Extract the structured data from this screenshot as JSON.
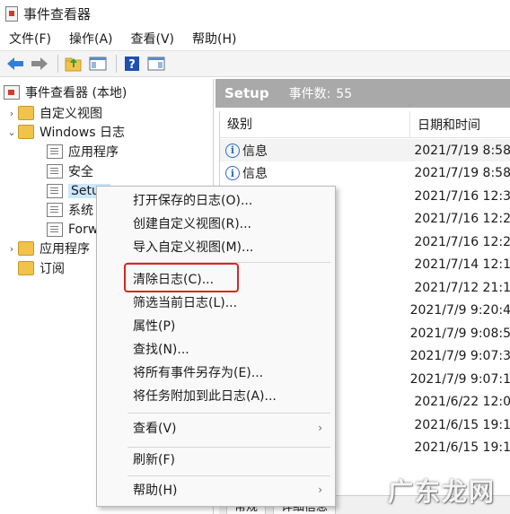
{
  "window": {
    "title": "事件查看器"
  },
  "menubar": [
    "文件(F)",
    "操作(A)",
    "查看(V)",
    "帮助(H)"
  ],
  "toolbar": {
    "icons": [
      "back-arrow-icon",
      "forward-arrow-icon",
      "folder-up-icon",
      "show-hide-tree-icon",
      "help-icon",
      "show-action-pane-icon"
    ]
  },
  "tree": {
    "root": "事件查看器 (本地)",
    "custom_views": "自定义视图",
    "windows_logs": "Windows 日志",
    "app": "应用程序",
    "security": "安全",
    "setup": "Setup",
    "system": "系统",
    "forwarded": "Forw",
    "apps_services": "应用程序",
    "subscriptions": "订阅"
  },
  "right": {
    "log_name": "Setup",
    "count_label": "事件数:",
    "count": "55",
    "columns": {
      "level": "级别",
      "date": "日期和时间"
    },
    "rows": [
      {
        "level": "信息",
        "date": "2021/7/19 8:58"
      },
      {
        "level": "信息",
        "date": "2021/7/19 8:58"
      },
      {
        "level": "",
        "date": "2021/7/16 12:3"
      },
      {
        "level": "",
        "date": "2021/7/16 12:2"
      },
      {
        "level": "",
        "date": "2021/7/16 12:2"
      },
      {
        "level": "",
        "date": "2021/7/14 12:1"
      },
      {
        "level": "",
        "date": "2021/7/12 21:1"
      },
      {
        "level": "",
        "date": "2021/7/9 9:20:4"
      },
      {
        "level": "",
        "date": "2021/7/9 9:08:5"
      },
      {
        "level": "",
        "date": "2021/7/9 9:07:3"
      },
      {
        "level": "",
        "date": "2021/7/9 9:07:1"
      },
      {
        "level": "",
        "date": "2021/6/22 12:0"
      },
      {
        "level": "",
        "date": "2021/6/15 19:1"
      },
      {
        "level": "",
        "date": "2021/6/15 19:1"
      }
    ],
    "bottom_tabs": [
      "常规",
      "详细信息"
    ]
  },
  "context_menu": {
    "open_saved": "打开保存的日志(O)...",
    "create_custom": "创建自定义视图(R)...",
    "import_custom": "导入自定义视图(M)...",
    "clear_log": "清除日志(C)...",
    "filter": "筛选当前日志(L)...",
    "properties": "属性(P)",
    "find": "查找(N)...",
    "save_all": "将所有事件另存为(E)...",
    "attach_task": "将任务附加到此日志(A)...",
    "view": "查看(V)",
    "refresh": "刷新(F)",
    "help": "帮助(H)",
    "submenu_arrow": "›"
  },
  "watermark": "广东龙网",
  "colors": {
    "highlight": "#d9261c",
    "selection": "#cce8ff",
    "header": "#a9a9a9"
  }
}
